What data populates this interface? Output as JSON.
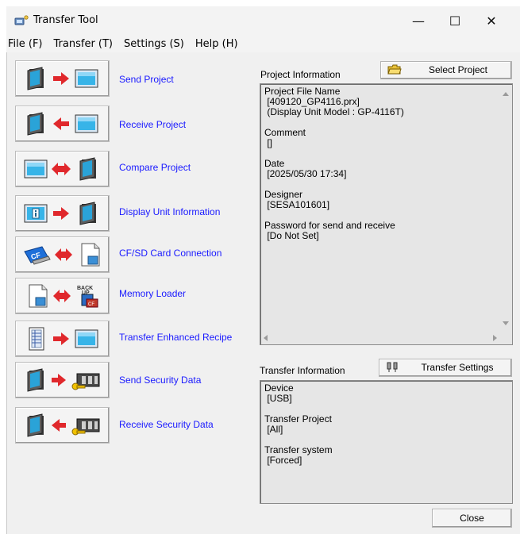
{
  "window": {
    "title": "Transfer Tool",
    "min_glyph": "—",
    "max_glyph": "☐",
    "close_glyph": "✕"
  },
  "menu": [
    {
      "label": "File (F)"
    },
    {
      "label": "Transfer (T)"
    },
    {
      "label": "Settings (S)"
    },
    {
      "label": "Help (H)"
    }
  ],
  "actions": [
    {
      "label": "Send Project",
      "icon": "send-project-icon"
    },
    {
      "label": "Receive Project",
      "icon": "receive-project-icon"
    },
    {
      "label": "Compare Project",
      "icon": "compare-project-icon"
    },
    {
      "label": "Display Unit Information",
      "icon": "display-unit-info-icon"
    },
    {
      "label": "CF/SD Card Connection",
      "icon": "cf-sd-card-icon"
    },
    {
      "label": "Memory Loader",
      "icon": "memory-loader-icon"
    },
    {
      "label": "Transfer Enhanced Recipe",
      "icon": "enhanced-recipe-icon"
    },
    {
      "label": "Send Security Data",
      "icon": "send-security-icon"
    },
    {
      "label": "Receive Security Data",
      "icon": "receive-security-icon"
    }
  ],
  "project_info": {
    "label": "Project Information",
    "select_button": "Select Project",
    "lines": {
      "file_name_label": "Project File Name",
      "file_name": " [409120_GP4116.prx]",
      "model": " (Display Unit Model : GP-4116T)",
      "comment_label": "Comment",
      "comment": " []",
      "date_label": "Date",
      "date": " [2025/05/30 17:34]",
      "designer_label": "Designer",
      "designer": " [SESA101601]",
      "password_label": "Password for send and receive",
      "password": " [Do Not Set]"
    }
  },
  "transfer_info": {
    "label": "Transfer Information",
    "settings_button": "Transfer Settings",
    "lines": {
      "device_label": "Device",
      "device": " [USB]",
      "project_label": "Transfer Project",
      "project": " [All]",
      "system_label": "Transfer system",
      "system": " [Forced]"
    }
  },
  "close_button": "Close",
  "colors": {
    "link_blue": "#1a1aff",
    "arrow_red": "#e0282c",
    "window_bg": "#f0f0f0",
    "info_bg": "#e6e6e6"
  }
}
